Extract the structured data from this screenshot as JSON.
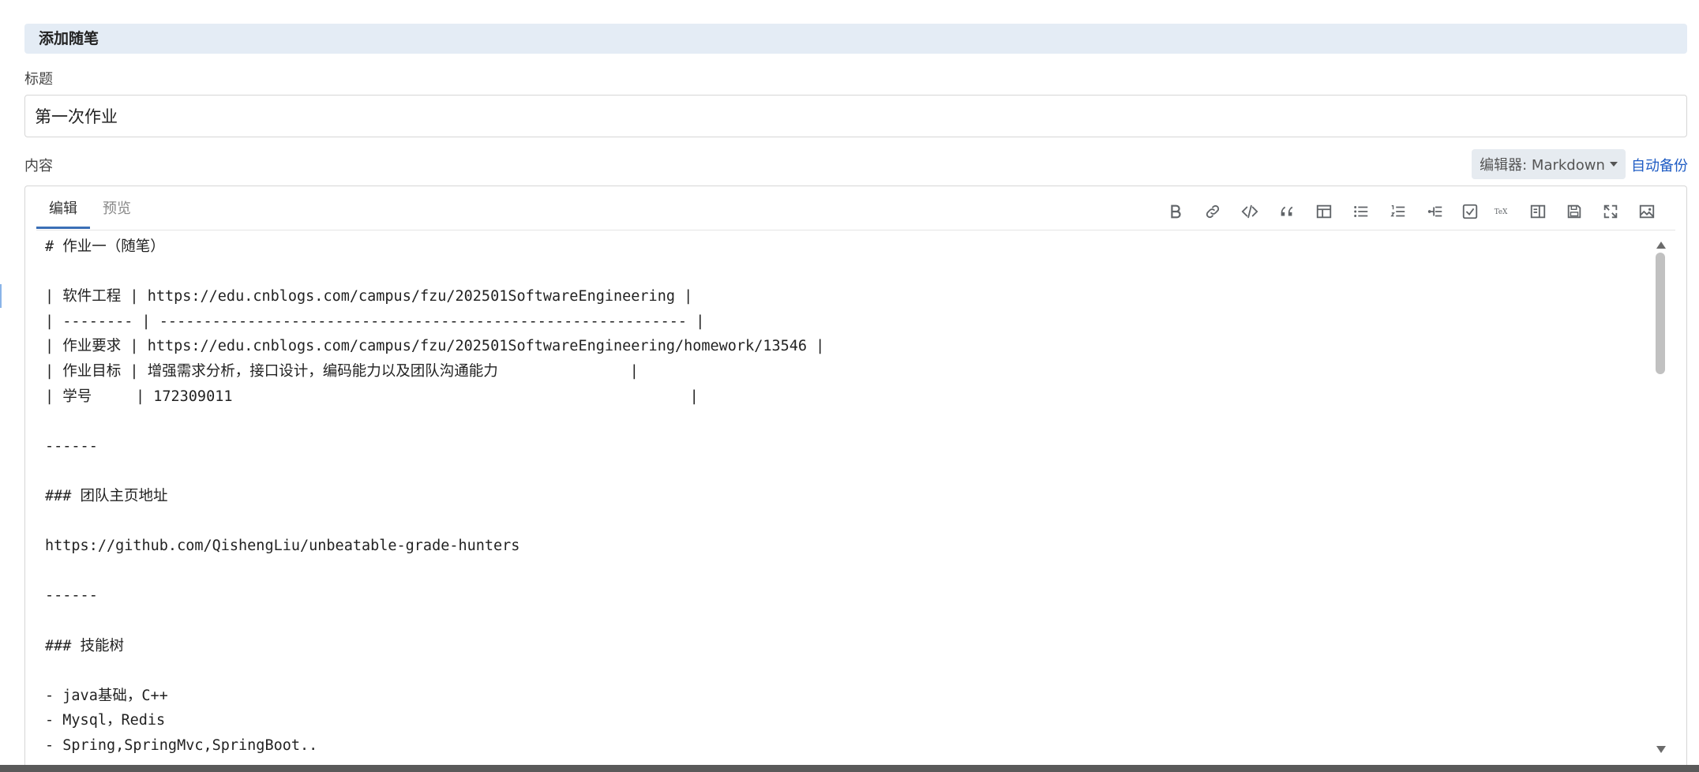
{
  "header": {
    "title": "添加随笔"
  },
  "title_field": {
    "label": "标题",
    "value": "第一次作业"
  },
  "content_field": {
    "label": "内容",
    "editor_select": "编辑器: Markdown",
    "auto_backup": "自动备份"
  },
  "editor": {
    "tabs": [
      {
        "label": "编辑",
        "active": true
      },
      {
        "label": "预览",
        "active": false
      }
    ],
    "toolbar": [
      "bold-icon",
      "link-icon",
      "code-icon",
      "quote-icon",
      "table-icon",
      "bullet-list-icon",
      "numbered-list-icon",
      "indent-list-icon",
      "checkbox-icon",
      "tex-icon",
      "side-by-side-icon",
      "save-icon",
      "fullscreen-icon",
      "image-icon"
    ],
    "lines": [
      "# 作业一（随笔）",
      "",
      "| 软件工程 | https://edu.cnblogs.com/campus/fzu/202501SoftwareEngineering |",
      "| -------- | ------------------------------------------------------------ |",
      "| 作业要求 | https://edu.cnblogs.com/campus/fzu/202501SoftwareEngineering/homework/13546 |",
      "| 作业目标 | 增强需求分析，接口设计，编码能力以及团队沟通能力               |",
      "| 学号     | 172309011                                                    |",
      "",
      "------",
      "",
      "### 团队主页地址",
      "",
      "https://github.com/QishengLiu/unbeatable-grade-hunters",
      "",
      "------",
      "",
      "### 技能树",
      "",
      "- java基础，C++",
      "- Mysql，Redis",
      "- Spring,SpringMvc,SpringBoot.."
    ]
  },
  "colors": {
    "header_bg": "#e4ecf5",
    "link": "#1f5cc4",
    "active_tab": "#3b6fb6"
  }
}
